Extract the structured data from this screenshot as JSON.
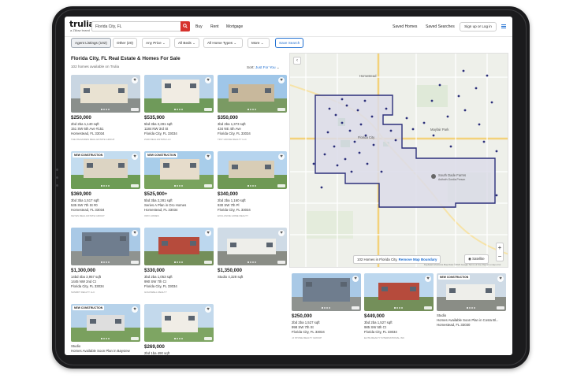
{
  "header": {
    "logo": "trulia",
    "logo_sub": "a Zillow brand",
    "search_value": "Florida City, FL",
    "nav": [
      "Buy",
      "Rent",
      "Mortgage"
    ],
    "saved_homes": "Saved Homes",
    "saved_searches": "Saved Searches",
    "signup": "Sign up or Log in"
  },
  "filters": {
    "agent_listings": "Agent Listings (102)",
    "other": "Other (20)",
    "any_price": "Any Price",
    "all_beds": "All Beds",
    "home_types": "All Home Types",
    "more": "More",
    "save_search": "Save Search"
  },
  "results": {
    "title": "Florida City, FL Real Estate & Homes For Sale",
    "count": "102 homes available on Trulia",
    "sort_label": "Sort:",
    "sort_value": "Just For You"
  },
  "listings": [
    {
      "price": "$250,000",
      "meta": "2bd  2ba  1,140 sqft",
      "addr1": "151 SW 6th Ave #151",
      "addr2": "Homestead, FL 33034",
      "broker": "The Palmares Real Estate Group",
      "badge": ""
    },
    {
      "price": "$535,900",
      "meta": "5bd  3ba  2,281 sqft",
      "addr1": "1184 NW 3rd St",
      "addr2": "Florida City, FL 33034",
      "broker": "Zaid Real Estate LLC",
      "badge": ""
    },
    {
      "price": "$350,000",
      "meta": "3bd  2ba  1,373 sqft",
      "addr1": "434 NE 4th Ave",
      "addr2": "Florida City, FL 33034",
      "broker": "Tiny House Realty LLC",
      "badge": ""
    },
    {
      "price": "$369,900",
      "meta": "3bd  3ba  1,517 sqft",
      "addr1": "535 SW 7th St #0",
      "addr2": "Homestead, FL 33034",
      "broker": "Keyes Real Estate Group",
      "badge": "NEW CONSTRUCTION"
    },
    {
      "price": "$525,900+",
      "meta": "5bd  3ba  2,281 sqft",
      "addr1": "Series A Plan in Oro Homes",
      "addr2": "Homestead, FL 33034",
      "broker": "Oro Homes",
      "badge": "NEW CONSTRUCTION"
    },
    {
      "price": "$340,000",
      "meta": "2bd  2ba  1,160 sqft",
      "addr1": "930 SW 7th Pl",
      "addr2": "Florida City, FL 33034",
      "broker": "Exclusive Home Realty",
      "badge": ""
    },
    {
      "price": "$1,300,000",
      "meta": "14bd  4ba  3,957 sqft",
      "addr1": "1445 NW 2nd Ct",
      "addr2": "Florida City, FL 33034",
      "broker": "Summit Realty LLC",
      "badge": ""
    },
    {
      "price": "$330,000",
      "meta": "3bd  2ba  1,053 sqft",
      "addr1": "990 SW 7th Ct",
      "addr2": "Florida City, FL 33034",
      "broker": "Goldwell Realty",
      "badge": ""
    },
    {
      "price": "$1,350,000",
      "meta": "Studio  4,328 sqft",
      "addr1": "",
      "addr2": "",
      "broker": "",
      "badge": ""
    },
    {
      "price": "",
      "meta": "Studio",
      "addr1": "Homes Available Soon Plan in Bayview",
      "addr2": "",
      "broker": "",
      "badge": "NEW CONSTRUCTION"
    },
    {
      "price": "$269,000",
      "meta": "2bd  1ba  490 sqft",
      "addr1": "",
      "addr2": "",
      "broker": "",
      "badge": ""
    }
  ],
  "map": {
    "caption_count": "102 Homes in Florida City,",
    "caption_link": "Remove Map Boundary",
    "satellite": "Satellite",
    "labels": [
      "Homestead",
      "Florida City",
      "Mayfair Park",
      "South Dade Farms",
      "Asthoth Gordia Person"
    ],
    "attribution": "Keyboard shortcuts   Map Data ©2023 Google   Terms of Use   Report a map error"
  },
  "map_listings": [
    {
      "price": "$250,000",
      "meta": "2bd  2ba  1,527 sqft",
      "addr1": "998 SW 7th St",
      "addr2": "Florida City, FL 33034",
      "broker": "JJ Stone Realty Group",
      "badge": ""
    },
    {
      "price": "$449,000",
      "meta": "3bd  2ba  1,527 sqft",
      "addr1": "985 SW 5th Ct",
      "addr2": "Florida City, FL 33034",
      "broker": "Elite Realty International Inc",
      "badge": ""
    },
    {
      "price": "",
      "meta": "Studio",
      "addr1": "Homes Available Soon Plan in Costa Bl...",
      "addr2": "Homestead, FL 33030",
      "broker": "",
      "badge": "NEW CONSTRUCTION"
    }
  ],
  "colors": {
    "accent": "#1f6fd1",
    "brand_red": "#d6322d",
    "boundary": "#2b2f7a"
  }
}
